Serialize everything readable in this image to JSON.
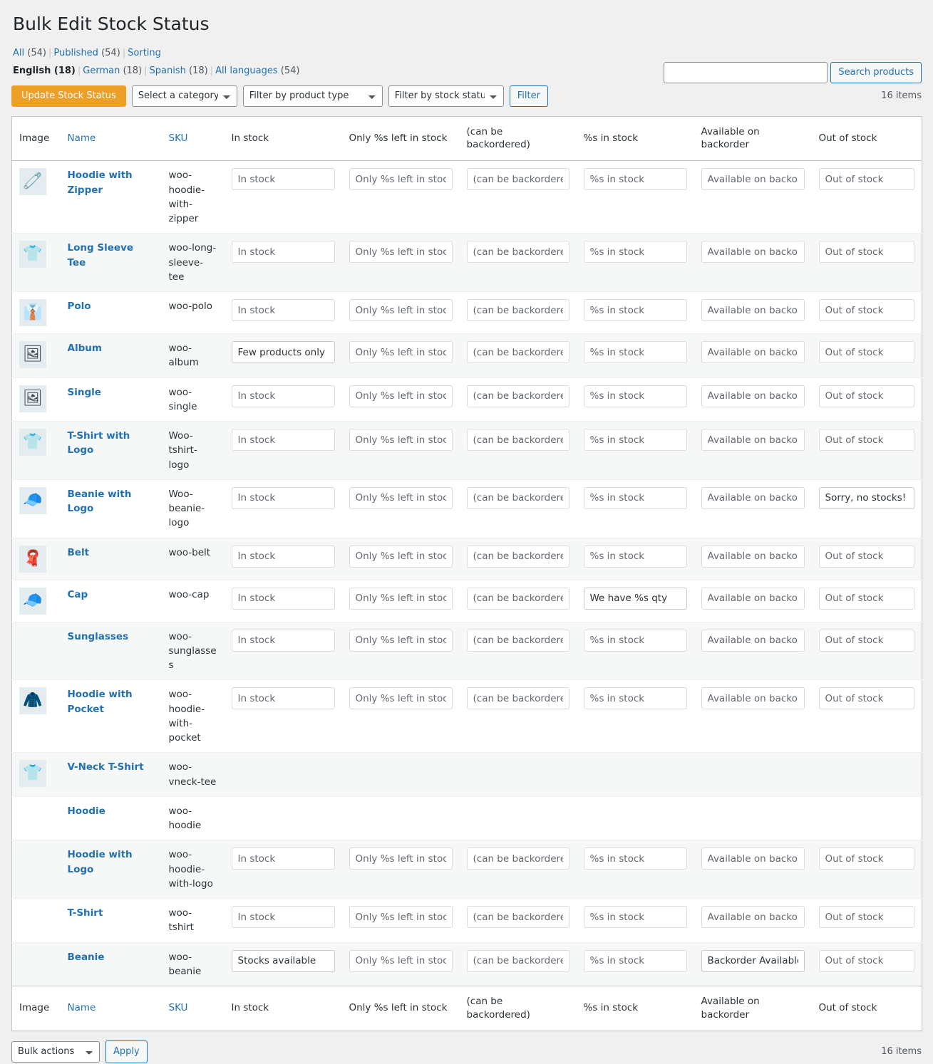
{
  "page": {
    "title": "Bulk Edit Stock Status"
  },
  "views": {
    "all_label": "All",
    "all_count": "(54)",
    "published_label": "Published",
    "published_count": "(54)",
    "sorting_label": "Sorting",
    "sep": "|"
  },
  "languages": {
    "english_label": "English (18)",
    "german_label": "German",
    "german_count": "(18)",
    "spanish_label": "Spanish",
    "spanish_count": "(18)",
    "all_label": "All languages",
    "all_count": "(54)"
  },
  "search": {
    "value": "",
    "placeholder": "",
    "button_label": "Search products"
  },
  "toolbar": {
    "update_label": "Update Stock Status",
    "category_selected": "Select a category",
    "product_type_selected": "Filter by product type",
    "stock_status_selected": "Filter by stock status",
    "filter_label": "Filter",
    "items_count": "16 items"
  },
  "columns": {
    "image": "Image",
    "name": "Name",
    "sku": "SKU",
    "in_stock": "In stock",
    "only_left": "Only %s left in stock",
    "backordered": "(can be backordered)",
    "pct_in_stock": "%s in stock",
    "available_backorder": "Available on backorder",
    "out_of_stock": "Out of stock"
  },
  "placeholders": {
    "in_stock": "In stock",
    "only_left": "Only %s left in stock",
    "backordered": "(can be backordered)",
    "pct_in_stock": "%s in stock",
    "available_backorder": "Available on backorder",
    "out_of_stock": "Out of stock"
  },
  "rows": [
    {
      "name": "Hoodie with Zipper",
      "sku": "woo-hoodie-with-zipper",
      "icon": "hoodie-zipper-thumbnail",
      "glyph": "🧷",
      "has_thumb": true,
      "has_fields": true,
      "in_stock": "",
      "only_left": "",
      "backordered": "",
      "pct_in_stock": "",
      "available_backorder": "",
      "out_of_stock": ""
    },
    {
      "name": "Long Sleeve Tee",
      "sku": "woo-long-sleeve-tee",
      "icon": "long-sleeve-tee-thumbnail",
      "glyph": "👕",
      "has_thumb": true,
      "has_fields": true,
      "in_stock": "",
      "only_left": "",
      "backordered": "",
      "pct_in_stock": "",
      "available_backorder": "",
      "out_of_stock": ""
    },
    {
      "name": "Polo",
      "sku": "woo-polo",
      "icon": "polo-thumbnail",
      "glyph": "👔",
      "has_thumb": true,
      "has_fields": true,
      "in_stock": "",
      "only_left": "",
      "backordered": "",
      "pct_in_stock": "",
      "available_backorder": "",
      "out_of_stock": ""
    },
    {
      "name": "Album",
      "sku": "woo-album",
      "icon": "album-thumbnail",
      "glyph": "🖼",
      "has_thumb": true,
      "has_fields": true,
      "in_stock": "Few products only available",
      "only_left": "",
      "backordered": "",
      "pct_in_stock": "",
      "available_backorder": "",
      "out_of_stock": ""
    },
    {
      "name": "Single",
      "sku": "woo-single",
      "icon": "single-thumbnail",
      "glyph": "🖼",
      "has_thumb": true,
      "has_fields": true,
      "in_stock": "",
      "only_left": "",
      "backordered": "",
      "pct_in_stock": "",
      "available_backorder": "",
      "out_of_stock": ""
    },
    {
      "name": "T-Shirt with Logo",
      "sku": "Woo-tshirt-logo",
      "icon": "tshirt-logo-thumbnail",
      "glyph": "👕",
      "has_thumb": true,
      "has_fields": true,
      "in_stock": "",
      "only_left": "",
      "backordered": "",
      "pct_in_stock": "",
      "available_backorder": "",
      "out_of_stock": ""
    },
    {
      "name": "Beanie with Logo",
      "sku": "Woo-beanie-logo",
      "icon": "beanie-logo-thumbnail",
      "glyph": "🧢",
      "has_thumb": true,
      "has_fields": true,
      "in_stock": "",
      "only_left": "",
      "backordered": "",
      "pct_in_stock": "",
      "available_backorder": "",
      "out_of_stock": "Sorry, no stocks!"
    },
    {
      "name": "Belt",
      "sku": "woo-belt",
      "icon": "belt-thumbnail",
      "glyph": "🧣",
      "has_thumb": true,
      "has_fields": true,
      "in_stock": "",
      "only_left": "",
      "backordered": "",
      "pct_in_stock": "",
      "available_backorder": "",
      "out_of_stock": ""
    },
    {
      "name": "Cap",
      "sku": "woo-cap",
      "icon": "cap-thumbnail",
      "glyph": "🧢",
      "has_thumb": true,
      "has_fields": true,
      "in_stock": "",
      "only_left": "",
      "backordered": "",
      "pct_in_stock": "We have %s qty",
      "available_backorder": "",
      "out_of_stock": ""
    },
    {
      "name": "Sunglasses",
      "sku": "woo-sunglasses",
      "icon": "sunglasses-thumbnail",
      "glyph": "",
      "has_thumb": false,
      "has_fields": true,
      "in_stock": "",
      "only_left": "",
      "backordered": "",
      "pct_in_stock": "",
      "available_backorder": "",
      "out_of_stock": ""
    },
    {
      "name": "Hoodie with Pocket",
      "sku": "woo-hoodie-with-pocket",
      "icon": "hoodie-pocket-thumbnail",
      "glyph": "🧥",
      "has_thumb": true,
      "has_fields": true,
      "in_stock": "",
      "only_left": "",
      "backordered": "",
      "pct_in_stock": "",
      "available_backorder": "",
      "out_of_stock": ""
    },
    {
      "name": "V-Neck T-Shirt",
      "sku": "woo-vneck-tee",
      "icon": "vneck-tshirt-thumbnail",
      "glyph": "👕",
      "has_thumb": true,
      "has_fields": false,
      "in_stock": "",
      "only_left": "",
      "backordered": "",
      "pct_in_stock": "",
      "available_backorder": "",
      "out_of_stock": ""
    },
    {
      "name": "Hoodie",
      "sku": "woo-hoodie",
      "icon": "hoodie-thumbnail",
      "glyph": "",
      "has_thumb": false,
      "has_fields": false,
      "in_stock": "",
      "only_left": "",
      "backordered": "",
      "pct_in_stock": "",
      "available_backorder": "",
      "out_of_stock": ""
    },
    {
      "name": "Hoodie with Logo",
      "sku": "woo-hoodie-with-logo",
      "icon": "hoodie-logo-thumbnail",
      "glyph": "",
      "has_thumb": false,
      "has_fields": true,
      "in_stock": "",
      "only_left": "",
      "backordered": "",
      "pct_in_stock": "",
      "available_backorder": "",
      "out_of_stock": ""
    },
    {
      "name": "T-Shirt",
      "sku": "woo-tshirt",
      "icon": "tshirt-thumbnail",
      "glyph": "",
      "has_thumb": false,
      "has_fields": true,
      "in_stock": "",
      "only_left": "",
      "backordered": "",
      "pct_in_stock": "",
      "available_backorder": "",
      "out_of_stock": ""
    },
    {
      "name": "Beanie",
      "sku": "woo-beanie",
      "icon": "beanie-thumbnail",
      "glyph": "",
      "has_thumb": false,
      "has_fields": true,
      "in_stock": "Stocks available",
      "only_left": "",
      "backordered": "",
      "pct_in_stock": "",
      "available_backorder": "Backorder Available",
      "out_of_stock": ""
    }
  ],
  "footer": {
    "bulk_actions_selected": "Bulk actions",
    "apply_label": "Apply",
    "items_count": "16 items"
  },
  "colors": {
    "primary_button": "#eda028",
    "link": "#2271b1",
    "page_background": "#f0f0f1",
    "table_background": "#ffffff",
    "alt_row": "#f6f7f7"
  }
}
